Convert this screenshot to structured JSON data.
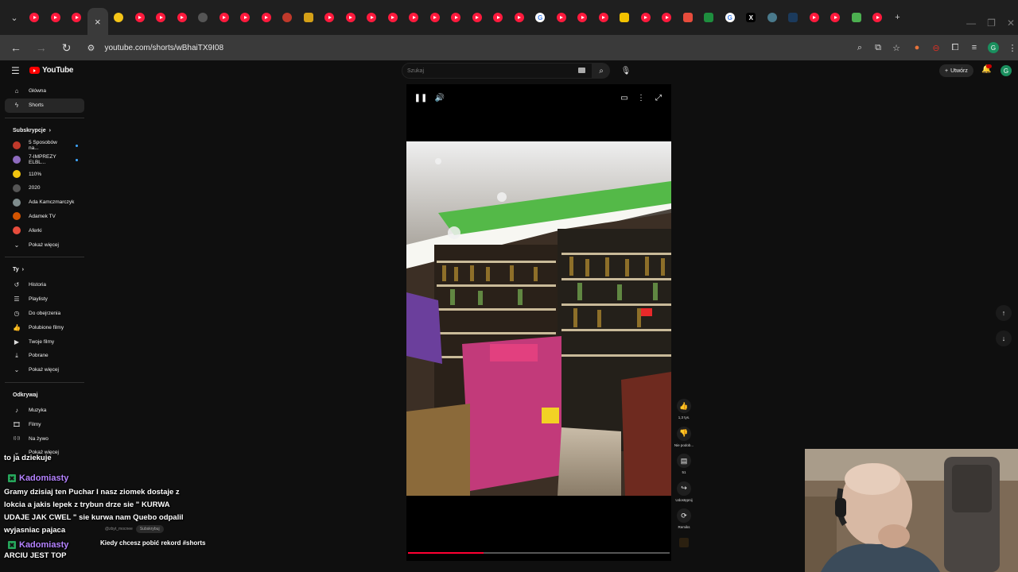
{
  "browser": {
    "url": "youtube.com/shorts/wBhaiTX9I08",
    "tab_close_glyph": "×",
    "new_tab_glyph": "+"
  },
  "youtube": {
    "logo_text": "YouTube",
    "search_placeholder": "Szukaj",
    "create_label": "Utwórz",
    "account_initial": "G"
  },
  "sidebar": {
    "main": [
      {
        "label": "Główna",
        "icon": "home-icon"
      },
      {
        "label": "Shorts",
        "icon": "shorts-icon"
      }
    ],
    "subs_heading": "Subskrypcje",
    "subscriptions": [
      {
        "label": "5 Sposobów na...",
        "color": "#c0392b",
        "live": true
      },
      {
        "label": "7-IMPREZY ELBL...",
        "color": "#8e6bbf",
        "live": true
      },
      {
        "label": "110%",
        "color": "#f1c40f",
        "live": false
      },
      {
        "label": "2020",
        "color": "#555555",
        "live": false
      },
      {
        "label": "Ada Kamczmarczyk",
        "color": "#7f8c8d",
        "live": false
      },
      {
        "label": "Adamek TV",
        "color": "#d35400",
        "live": false
      },
      {
        "label": "Aferki",
        "color": "#e74c3c",
        "live": false
      }
    ],
    "subs_more": "Pokaż więcej",
    "you_heading": "Ty",
    "you_items": [
      {
        "label": "Historia",
        "icon": "history-icon"
      },
      {
        "label": "Playlisty",
        "icon": "playlist-icon"
      },
      {
        "label": "Do obejrzenia",
        "icon": "watch-later-icon"
      },
      {
        "label": "Polubione filmy",
        "icon": "liked-icon"
      },
      {
        "label": "Twoje filmy",
        "icon": "your-videos-icon"
      },
      {
        "label": "Pobrane",
        "icon": "download-icon"
      },
      {
        "label": "Pokaż więcej",
        "icon": "chevron-down-icon"
      }
    ],
    "explore_heading": "Odkrywaj",
    "explore_items": [
      {
        "label": "Muzyka",
        "icon": "music-icon"
      },
      {
        "label": "Filmy",
        "icon": "film-icon"
      },
      {
        "label": "Na żywo",
        "icon": "live-icon"
      },
      {
        "label": "Pokaż więcej",
        "icon": "chevron-down-icon"
      }
    ]
  },
  "actions": {
    "likes": "1,3 tys.",
    "dislike_label": "Nie podob...",
    "comments": "51",
    "share_label": "Udostępnij",
    "remix_label": "Remiks"
  },
  "player": {
    "progress": 0.29
  },
  "stream_chat": {
    "line1": "to ja dziekuje",
    "user1": "Kadomiasty",
    "message1": "Gramy dzisiaj ten Puchar I nasz ziomek dostaje z lokcia a jakis lepek z trybun drze sie \" KURWA UDAJE JAK CWEL \" sie kurwa nam Quebo odpalil wyjasniac pajaca",
    "user2": "Kadomiasty",
    "message2": "ARCIU JEST TOP",
    "ghost_channel": "@zbyt_mocnee",
    "ghost_subscribe": "Subskrybuj"
  },
  "short": {
    "caption": "Kiedy chcesz pobić rekord #shorts"
  }
}
